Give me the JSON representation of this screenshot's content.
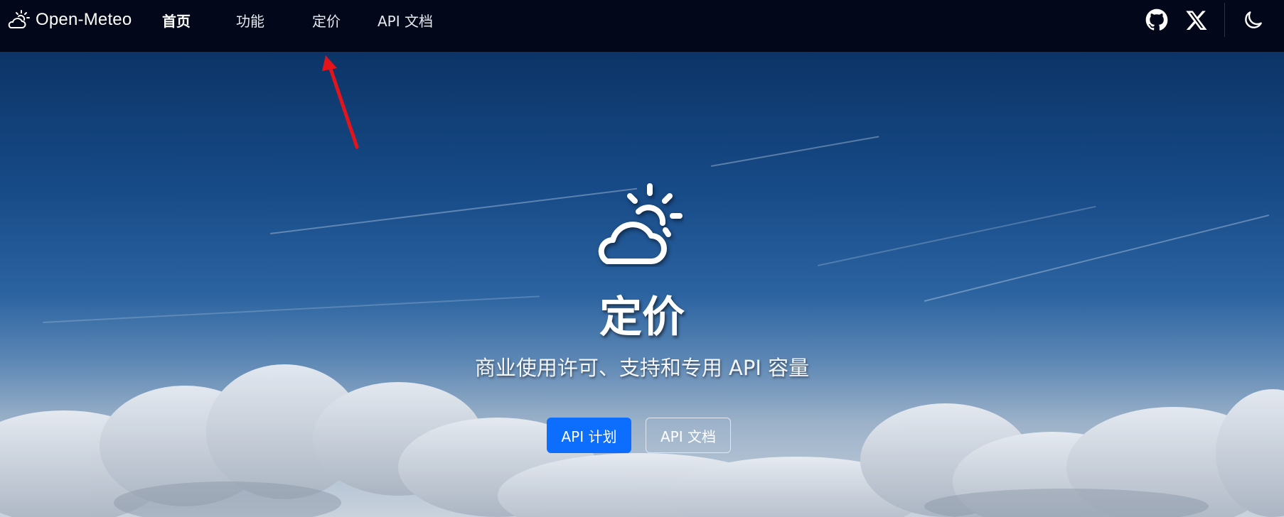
{
  "navbar": {
    "brand": "Open-Meteo",
    "links": [
      {
        "label": "首页",
        "active": true
      },
      {
        "label": "功能",
        "active": false
      },
      {
        "label": "定价",
        "active": false
      },
      {
        "label": "API 文档",
        "active": false
      }
    ],
    "right_icons": [
      "github-icon",
      "x-twitter-icon",
      "moon-icon"
    ]
  },
  "hero": {
    "icon": "cloud-sun-icon",
    "title": "定价",
    "subtitle": "商业使用许可、支持和专用 API 容量",
    "primary_button": "API 计划",
    "secondary_button": "API 文档"
  },
  "colors": {
    "navbar_bg": "#02071a",
    "primary": "#0d6efd",
    "annotation_arrow": "#e5141b"
  }
}
